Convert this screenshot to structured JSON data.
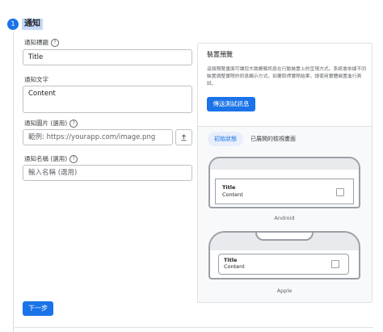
{
  "step": {
    "number": "1",
    "title": "通知"
  },
  "form": {
    "title_label": "通知標題",
    "title_value": "Title",
    "text_label": "通知文字",
    "text_value": "Content",
    "image_label": "通知圖片 (選用)",
    "image_placeholder": "範例: https://yourapp.com/image.png",
    "name_label": "通知名稱 (選用)",
    "name_placeholder": "輸入名稱 (選用)"
  },
  "next_button": "下一步",
  "preview": {
    "title": "裝置預覽",
    "description": "這個預覽畫面可讓您大致瞭解訊息在行動裝置上的呈現方式。系統會依據不同裝置調整實際的訊息顯示方式。如要取得實際結果，請使用實體裝置進行測試。",
    "test_button": "傳送測試訊息",
    "tab_initial": "初始狀態",
    "tab_expanded": "已展開的檢視畫面",
    "android": {
      "notif_title": "Title",
      "notif_content": "Content",
      "caption": "Android"
    },
    "apple": {
      "notif_title": "Title",
      "notif_content": "Content",
      "caption": "Apple"
    }
  }
}
